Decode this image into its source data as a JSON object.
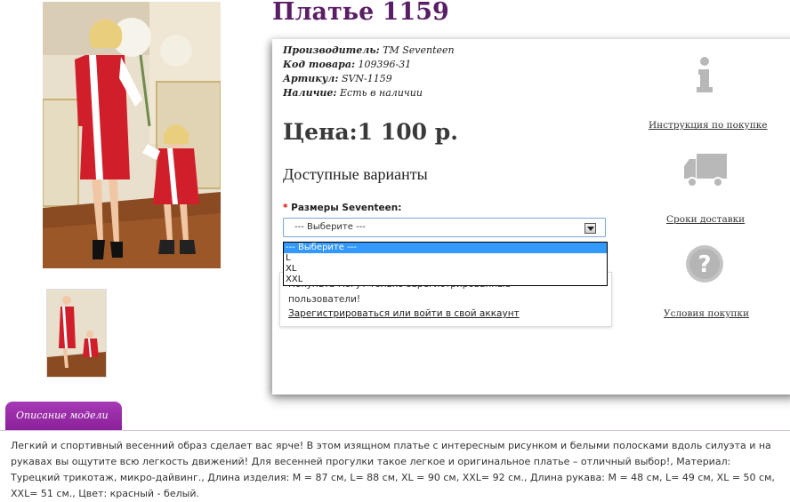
{
  "product": {
    "title": "Платье 1159",
    "manufacturer_label": "Производитель:",
    "manufacturer": "ТМ Seventeen",
    "code_label": "Код товара:",
    "code": "109396-31",
    "article_label": "Артикул:",
    "article": "SVN-1159",
    "availability_label": "Наличие:",
    "availability": "Есть в наличии",
    "price": "Цена:1 100 р."
  },
  "options": {
    "heading": "Доступные варианты",
    "size_label": "Размеры Seventeen:",
    "required_mark": "*",
    "selected": "--- Выберите ---",
    "items": [
      "--- Выберите ---",
      "L",
      "XL",
      "XXL"
    ]
  },
  "notice": {
    "line1": "Покупать могут только зарегистрированные",
    "line2": "пользователи!",
    "link": "Зарегистрироваться или войти в свой аккаунт"
  },
  "sidebar": {
    "instructions": "Инструкция по покупке",
    "delivery": "Сроки доставки",
    "conditions": "Условия покупки"
  },
  "tabs": {
    "description": "Описание модели"
  },
  "description": {
    "text": "Легкий и спортивный весенний образ сделает вас ярче! В этом изящном платье с интересным рисунком и белыми полосками вдоль силуэта и на рукавах вы ощутите всю легкость движений! Для весенней прогулки такое легкое и оригинальное платье – отличный выбор!, Материал: Турецкий трикотаж, микро-дайвинг., Длина изделия: M = 87 см, L= 88 см, XL = 90 см, XXL= 92 см., Длина рукава: M = 48 см, L= 49 см, XL = 50 см, XXL= 51 см., Цвет: красный - белый."
  },
  "colors": {
    "title": "#5a1e66",
    "tab": "#9b2aad",
    "dress": "#d01f2a",
    "select_highlight": "#3399ff"
  }
}
